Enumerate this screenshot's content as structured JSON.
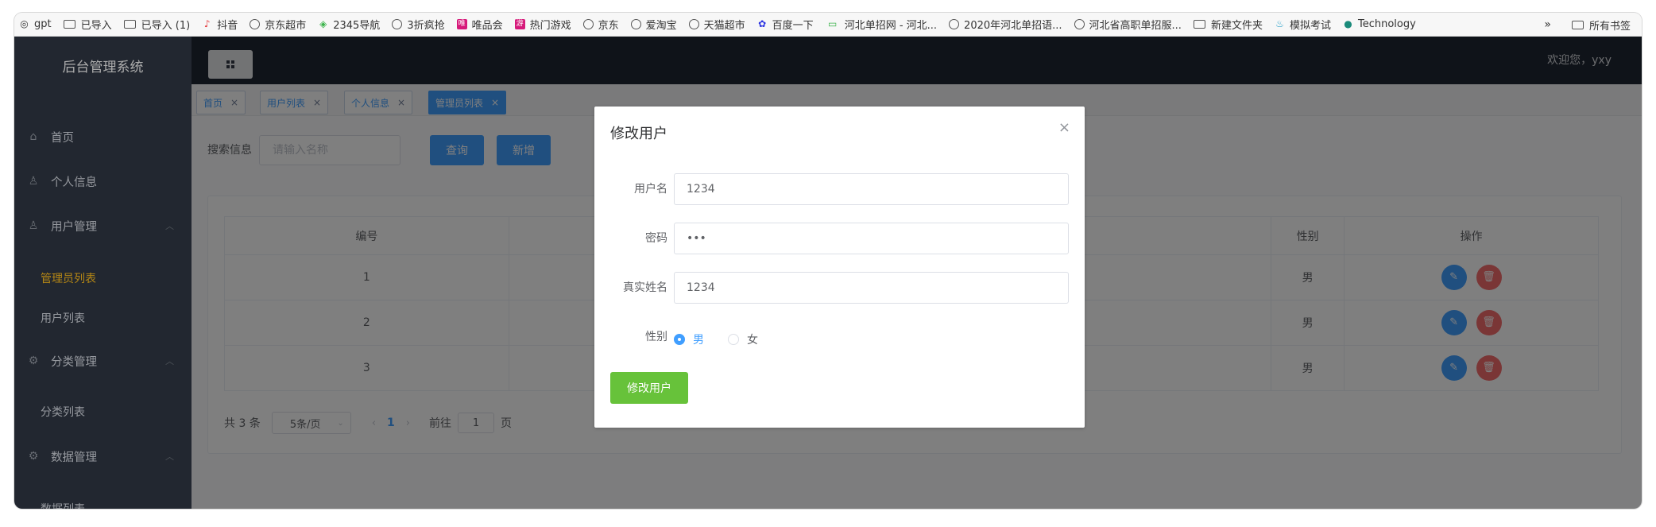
{
  "bookmarks": {
    "items": [
      {
        "label": "gpt",
        "icon": "gpt-icon"
      },
      {
        "label": "已导入",
        "icon": "folder-icon"
      },
      {
        "label": "已导入 (1)",
        "icon": "folder-icon"
      },
      {
        "label": "抖音",
        "icon": "douyin-icon"
      },
      {
        "label": "京东超市",
        "icon": "globe-icon"
      },
      {
        "label": "2345导航",
        "icon": "nav2345-icon"
      },
      {
        "label": "3折疯抢",
        "icon": "globe-icon"
      },
      {
        "label": "唯品会",
        "icon": "vip-icon"
      },
      {
        "label": "热门游戏",
        "icon": "game-icon"
      },
      {
        "label": "京东",
        "icon": "globe-icon"
      },
      {
        "label": "爱淘宝",
        "icon": "globe-icon"
      },
      {
        "label": "天猫超市",
        "icon": "globe-icon"
      },
      {
        "label": "百度一下",
        "icon": "baidu-icon"
      },
      {
        "label": "河北单招网 - 河北...",
        "icon": "hebei-icon"
      },
      {
        "label": "2020年河北单招语...",
        "icon": "globe-icon"
      },
      {
        "label": "河北省高职单招服...",
        "icon": "globe-icon"
      },
      {
        "label": "新建文件夹",
        "icon": "folder-icon"
      },
      {
        "label": "模拟考试",
        "icon": "fire-icon"
      },
      {
        "label": "Technology",
        "icon": "tech-icon"
      }
    ],
    "more": "»",
    "all": "所有书签"
  },
  "sidebar": {
    "brand": "后台管理系统",
    "menu": [
      {
        "label": "首页",
        "icon": "home-icon"
      },
      {
        "label": "个人信息",
        "icon": "user-icon"
      },
      {
        "label": "用户管理",
        "icon": "user-icon"
      },
      {
        "label": "分类管理",
        "icon": "gear-icon"
      },
      {
        "label": "数据管理",
        "icon": "gear-icon"
      }
    ],
    "sub": [
      "管理员列表",
      "用户列表",
      "分类列表",
      "数据列表"
    ]
  },
  "header": {
    "welcome": "欢迎您，yxy"
  },
  "tags": [
    {
      "label": "首页",
      "close": "×"
    },
    {
      "label": "用户列表",
      "close": "×"
    },
    {
      "label": "个人信息",
      "close": "×"
    },
    {
      "label": "管理员列表",
      "close": "×"
    }
  ],
  "search": {
    "label": "搜索信息",
    "placeholder": "请输入名称",
    "query": "查询",
    "add": "新增"
  },
  "table": {
    "headers": [
      "编号",
      "",
      "",
      "性别",
      "操作"
    ],
    "rows": [
      {
        "id": "1",
        "gender": "男"
      },
      {
        "id": "2",
        "gender": "男"
      },
      {
        "id": "3",
        "gender": "男"
      }
    ]
  },
  "pager": {
    "total": "共 3 条",
    "size": "5条/页",
    "page": "1",
    "goto": "前往",
    "goto_value": "1",
    "page_unit": "页"
  },
  "dialog": {
    "title": "修改用户",
    "close": "×",
    "username_label": "用户名",
    "username": "1234",
    "password_label": "密码",
    "password": "•••",
    "realname_label": "真实姓名",
    "realname": "1234",
    "gender_label": "性别",
    "male": "男",
    "female": "女",
    "submit": "修改用户"
  },
  "colors": {
    "primary": "#409eff",
    "success": "#67c23a",
    "danger": "#f56c6c",
    "active_menu": "#f1b31c"
  }
}
